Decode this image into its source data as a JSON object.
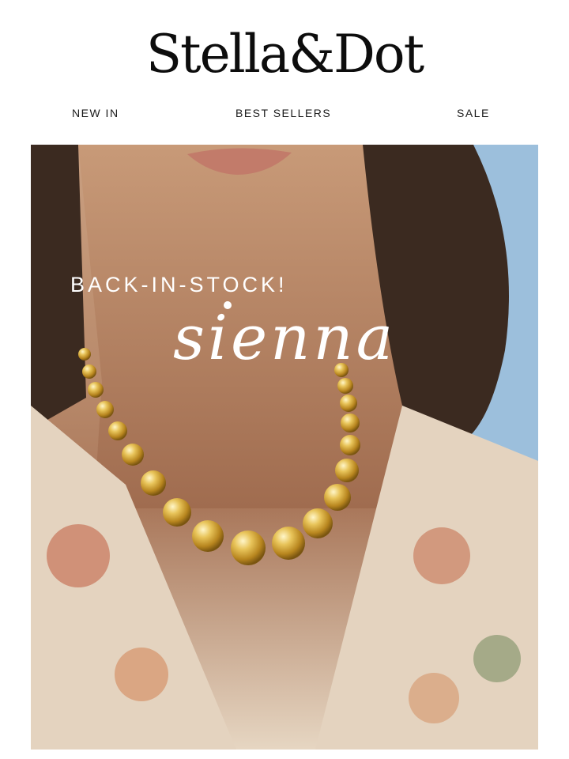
{
  "brand": {
    "logo_text": "Stella&Dot"
  },
  "nav": {
    "items": [
      {
        "label": "NEW IN"
      },
      {
        "label": "BEST SELLERS"
      },
      {
        "label": "SALE"
      }
    ]
  },
  "hero": {
    "eyebrow": "BACK-IN-STOCK!",
    "title": "sienna",
    "image_alt": "model wearing gold bead necklace"
  },
  "colors": {
    "background": "#ffffff",
    "text": "#111111",
    "hero_text": "#ffffff",
    "gold": "#c9a227"
  }
}
